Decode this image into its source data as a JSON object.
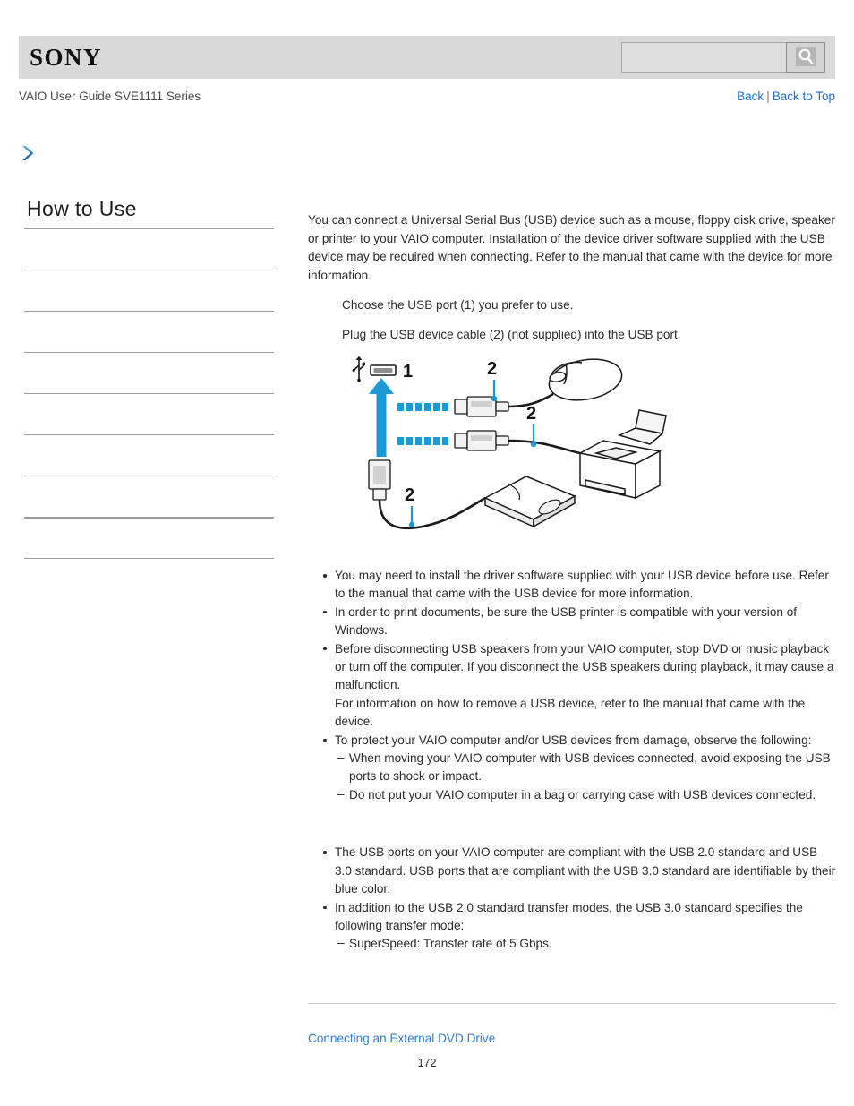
{
  "header": {
    "logo_text": "SONY",
    "search": {
      "value": "",
      "placeholder": "",
      "icon": "search-icon",
      "button_label": ""
    }
  },
  "subheader": {
    "guide_title": "VAIO User Guide SVE1111 Series",
    "links": [
      {
        "label": "Back"
      },
      {
        "label": "Back to Top"
      }
    ],
    "separator": "|"
  },
  "chevron": {
    "icon": "chevron-right-icon"
  },
  "sidebar": {
    "title": "How to Use",
    "rows": [
      {
        "label": ""
      },
      {
        "label": ""
      },
      {
        "label": ""
      },
      {
        "label": ""
      },
      {
        "label": ""
      },
      {
        "label": ""
      },
      {
        "label": ""
      },
      {
        "label": ""
      },
      {
        "label": ""
      }
    ]
  },
  "main": {
    "intro": "You can connect a Universal Serial Bus (USB) device such as a mouse, floppy disk drive, speaker or printer to your VAIO computer. Installation of the device driver software supplied with the USB device may be required when connecting. Refer to the manual that came with the device for more information.",
    "steps": [
      "Choose the USB port (1) you prefer to use.",
      "Plug the USB device cable (2) (not supplied) into the USB port."
    ],
    "figure": {
      "name": "usb-connection-diagram",
      "callouts": [
        {
          "label": "1",
          "meaning": "USB port"
        },
        {
          "label": "2",
          "meaning": "USB device cable to mouse"
        },
        {
          "label": "2",
          "meaning": "USB device cable to printer"
        },
        {
          "label": "2",
          "meaning": "USB device cable to floppy disk drive"
        }
      ],
      "devices": [
        "usb-port-icon",
        "mouse",
        "printer",
        "floppy-disk-drive"
      ],
      "accent_color": "#1b9ad6"
    },
    "notes_group_1": [
      {
        "text": "You may need to install the driver software supplied with your USB device before use. Refer to the manual that came with the USB device for more information.",
        "subitems": []
      },
      {
        "text": "In order to print documents, be sure the USB printer is compatible with your version of Windows.",
        "subitems": []
      },
      {
        "text": "Before disconnecting USB speakers from your VAIO computer, stop DVD or music playback or turn off the computer. If you disconnect the USB speakers during playback, it may cause a malfunction.\nFor information on how to remove a USB device, refer to the manual that came with the device.",
        "subitems": []
      },
      {
        "text": "To protect your VAIO computer and/or USB devices from damage, observe the following:",
        "subitems": [
          "When moving your VAIO computer with USB devices connected, avoid exposing the USB ports to shock or impact.",
          "Do not put your VAIO computer in a bag or carrying case with USB devices connected."
        ]
      }
    ],
    "notes_group_2": [
      {
        "text": "The USB ports on your VAIO computer are compliant with the USB 2.0 standard and USB 3.0 standard. USB ports that are compliant with the USB 3.0 standard are identifiable by their blue color.",
        "subitems": []
      },
      {
        "text": "In addition to the USB 2.0 standard transfer modes, the USB 3.0 standard specifies the following transfer mode:",
        "subitems": [
          "SuperSpeed: Transfer rate of 5 Gbps."
        ]
      }
    ]
  },
  "footer": {
    "related_link": "Connecting an External DVD Drive",
    "page_number": "172"
  },
  "colors": {
    "link_blue": "#1a6fd0",
    "footer_link_blue": "#2f7fd8",
    "header_gray": "#d9d9d9",
    "rule_gray": "#9c9c9c",
    "diagram_accent": "#1b9ad6"
  }
}
